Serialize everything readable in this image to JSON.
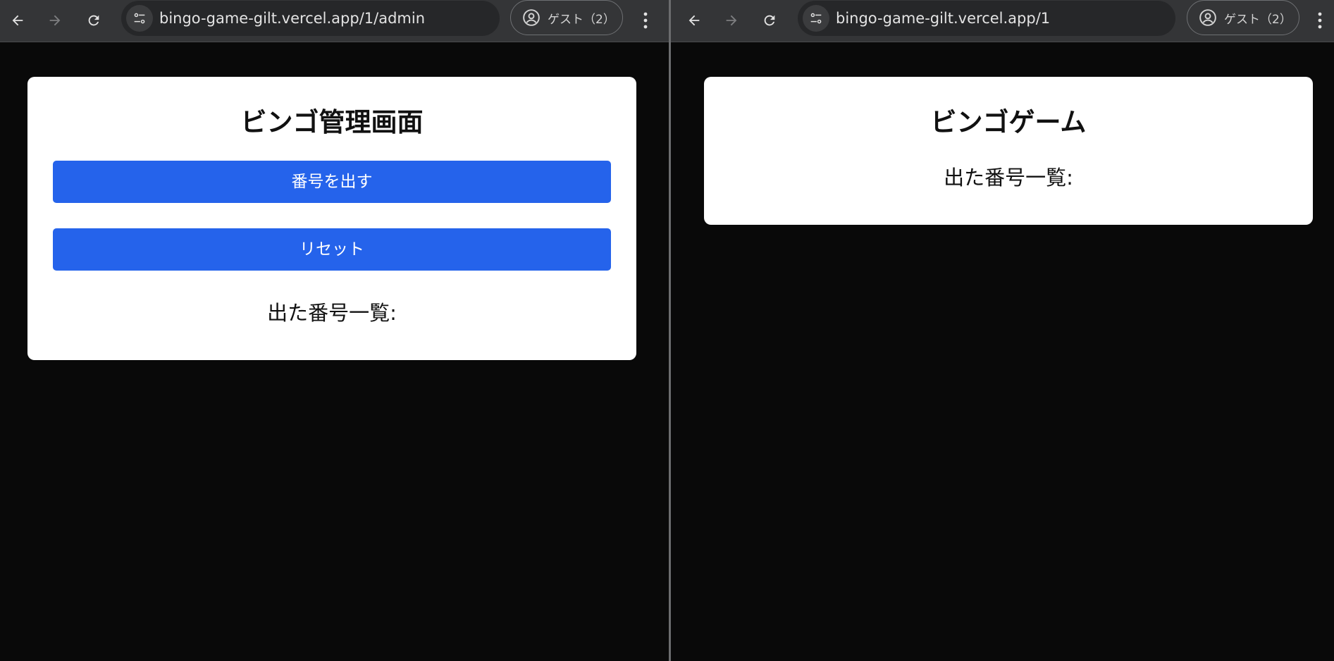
{
  "left_window": {
    "url": "bingo-game-gilt.vercel.app/1/admin",
    "profile_label": "ゲスト（2）",
    "card": {
      "title": "ビンゴ管理画面",
      "draw_button": "番号を出す",
      "reset_button": "リセット",
      "drawn_list_label": "出た番号一覧:"
    }
  },
  "right_window": {
    "url": "bingo-game-gilt.vercel.app/1",
    "profile_label": "ゲスト（2）",
    "card": {
      "title": "ビンゴゲーム",
      "drawn_list_label": "出た番号一覧:"
    }
  },
  "icons": {
    "back": "arrow-left-icon",
    "forward": "arrow-right-icon",
    "reload": "reload-icon",
    "site_settings": "tune-icon",
    "profile": "person-circle-icon",
    "menu": "more-vert-icon"
  },
  "colors": {
    "toolbar": "#343537",
    "page_background": "#090909",
    "card": "#ffffff",
    "button": "#2563eb"
  }
}
